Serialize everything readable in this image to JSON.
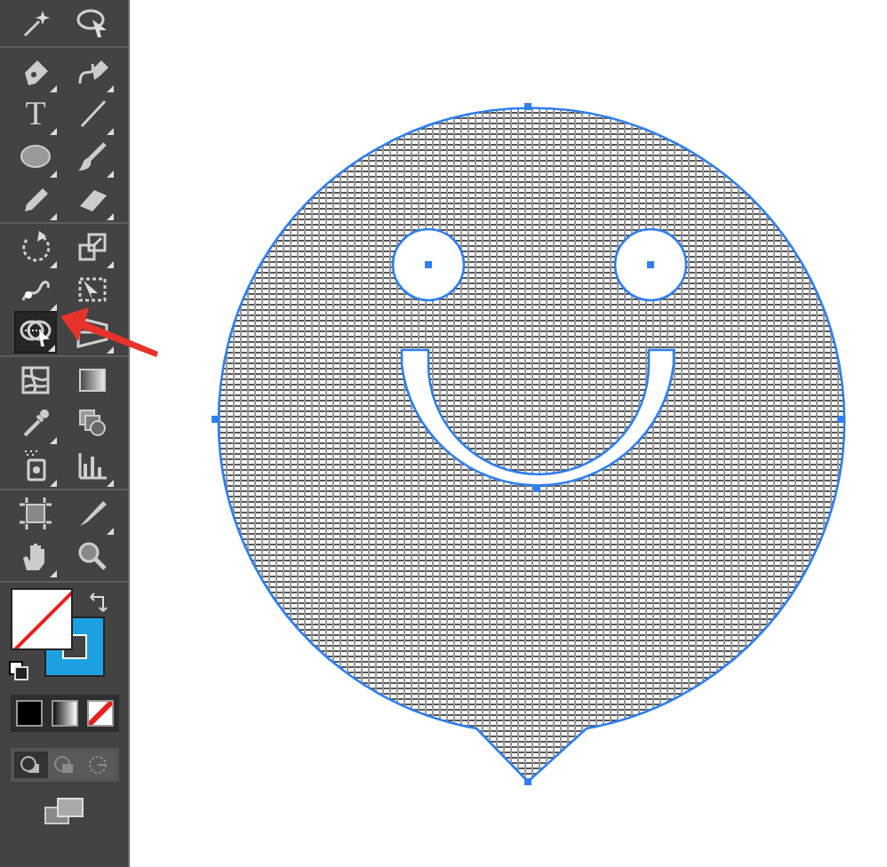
{
  "tool_groups": [
    {
      "rows": [
        {
          "tools": [
            {
              "kind": "magic-wand",
              "flyout": false,
              "selected": false
            },
            {
              "kind": "lasso",
              "flyout": false,
              "selected": false
            }
          ]
        }
      ]
    },
    {
      "rows": [
        {
          "tools": [
            {
              "kind": "pen",
              "flyout": true,
              "selected": false
            },
            {
              "kind": "curvature",
              "flyout": true,
              "selected": false
            }
          ]
        },
        {
          "tools": [
            {
              "kind": "type",
              "label": "T",
              "flyout": true,
              "selected": false
            },
            {
              "kind": "line",
              "flyout": true,
              "selected": false
            }
          ]
        },
        {
          "tools": [
            {
              "kind": "ellipse",
              "flyout": true,
              "selected": false
            },
            {
              "kind": "brush",
              "flyout": true,
              "selected": false
            }
          ]
        },
        {
          "tools": [
            {
              "kind": "pencil",
              "flyout": true,
              "selected": false
            },
            {
              "kind": "eraser",
              "flyout": true,
              "selected": false
            }
          ]
        }
      ]
    },
    {
      "rows": [
        {
          "tools": [
            {
              "kind": "rotate",
              "flyout": true,
              "selected": false
            },
            {
              "kind": "scale",
              "flyout": true,
              "selected": false
            }
          ]
        },
        {
          "tools": [
            {
              "kind": "warp",
              "flyout": true,
              "selected": false
            },
            {
              "kind": "free-transform",
              "flyout": false,
              "selected": false
            }
          ]
        },
        {
          "tools": [
            {
              "kind": "shape-builder",
              "flyout": true,
              "selected": true
            },
            {
              "kind": "perspective",
              "flyout": true,
              "selected": false
            }
          ]
        }
      ]
    },
    {
      "rows": [
        {
          "tools": [
            {
              "kind": "mesh",
              "flyout": false,
              "selected": false
            },
            {
              "kind": "gradient",
              "flyout": false,
              "selected": false
            }
          ]
        },
        {
          "tools": [
            {
              "kind": "eyedropper",
              "flyout": true,
              "selected": false
            },
            {
              "kind": "blend",
              "flyout": false,
              "selected": false
            }
          ]
        },
        {
          "tools": [
            {
              "kind": "sprayer",
              "flyout": true,
              "selected": false
            },
            {
              "kind": "graph",
              "flyout": true,
              "selected": false
            }
          ]
        }
      ]
    },
    {
      "rows": [
        {
          "tools": [
            {
              "kind": "artboard",
              "flyout": false,
              "selected": false
            },
            {
              "kind": "slice",
              "flyout": true,
              "selected": false
            }
          ]
        },
        {
          "tools": [
            {
              "kind": "hand",
              "flyout": true,
              "selected": false
            },
            {
              "kind": "zoom",
              "flyout": false,
              "selected": false
            }
          ]
        }
      ]
    }
  ],
  "fill": {
    "kind": "none"
  },
  "stroke": {
    "color": "#1ba1e2"
  },
  "color_modes": [
    {
      "kind": "color"
    },
    {
      "kind": "gradient"
    },
    {
      "kind": "none"
    }
  ],
  "draw_modes": [
    {
      "kind": "normal",
      "selected": true
    },
    {
      "kind": "behind",
      "selected": false
    },
    {
      "kind": "inside",
      "selected": false
    }
  ]
}
